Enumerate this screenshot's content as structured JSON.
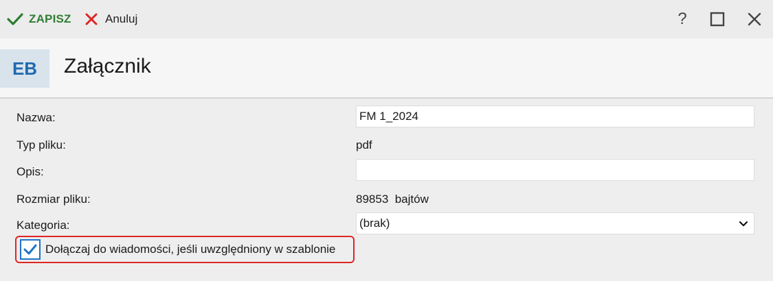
{
  "toolbar": {
    "save_label": "ZAPISZ",
    "cancel_label": "Anuluj",
    "help_label": "?"
  },
  "header": {
    "avatar_text": "EB",
    "title": "Załącznik"
  },
  "form": {
    "name_label": "Nazwa:",
    "name_value": "FM 1_2024",
    "type_label": "Typ pliku:",
    "type_value": "pdf",
    "desc_label": "Opis:",
    "desc_value": "",
    "size_label": "Rozmiar pliku:",
    "size_value": "89853  bajtów",
    "category_label": "Kategoria:",
    "category_value": "(brak)",
    "attach_label": "Dołączaj do wiadomości, jeśli uwzględniony w szablonie",
    "attach_checked": true
  },
  "colors": {
    "save": "#2e7d32",
    "cancel": "#e02424",
    "avatar_bg": "#d9e3ec",
    "avatar_fg": "#1f6ab0",
    "checkbox": "#1f73c8",
    "highlight": "#e02424"
  },
  "icons": {
    "save": "check-icon",
    "cancel": "x-icon",
    "maximize": "square-icon",
    "close": "close-icon",
    "dropdown": "chevron-down-icon"
  }
}
